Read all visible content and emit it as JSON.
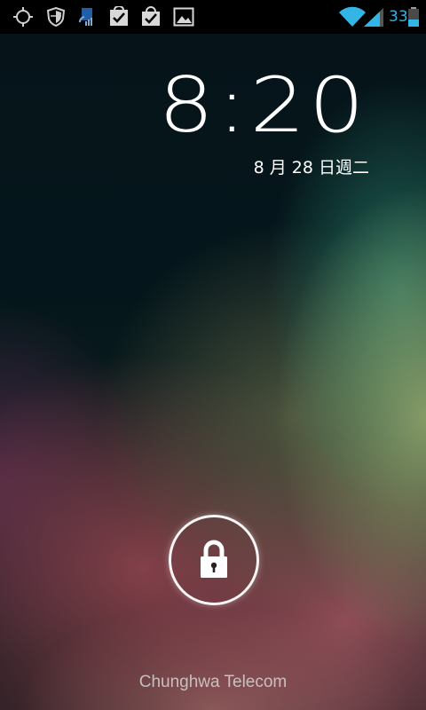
{
  "status_bar": {
    "notification_icons": [
      "gps-icon",
      "shield-icon",
      "data-sync-icon",
      "download-complete-icon",
      "download-complete-icon",
      "image-icon"
    ],
    "system_icons": [
      "wifi-icon",
      "signal-icon",
      "battery-icon"
    ],
    "battery_percent": "33",
    "accent_color": "#33b5e5"
  },
  "lockscreen": {
    "time": "8:20",
    "date": "8 月 28 日週二",
    "unlock_icon": "lock-icon",
    "carrier": "Chunghwa Telecom"
  }
}
